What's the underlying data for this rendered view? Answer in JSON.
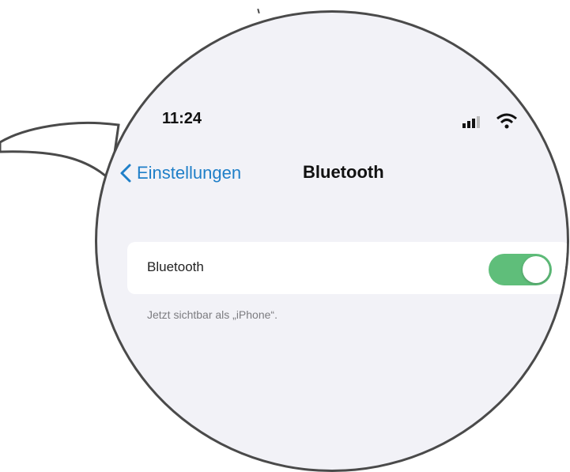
{
  "status_bar": {
    "time": "11:24",
    "icons": [
      "cellular-signal-icon",
      "wifi-icon"
    ]
  },
  "nav": {
    "back_icon": "chevron-left-icon",
    "back_label": "Einstellungen",
    "title": "Bluetooth"
  },
  "bluetooth_row": {
    "label": "Bluetooth",
    "toggle_on": true
  },
  "footnote": "Jetzt sichtbar als „iPhone“.",
  "colors": {
    "accent": "#1f7fc8",
    "toggle_on": "#5fbe7a",
    "background": "#f2f2f7",
    "outline": "#4a4a4a"
  }
}
